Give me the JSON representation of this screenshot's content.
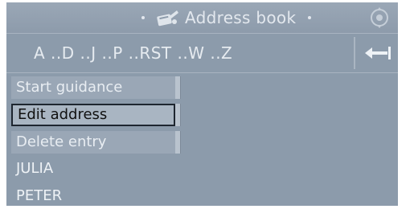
{
  "title_bar": {
    "title": "Address book",
    "book_icon": "address-book-icon",
    "controller_icon": "controller-icon"
  },
  "alpha_bar": {
    "text": "A ..D ..J ..P ..RST ..W ..Z",
    "back_icon": "back-arrow-icon"
  },
  "context_menu": {
    "items": [
      {
        "label": "Start guidance",
        "selected": false
      },
      {
        "label": "Edit address",
        "selected": true
      },
      {
        "label": "Delete entry",
        "selected": false
      }
    ]
  },
  "entries": [
    {
      "label": "JULIA"
    },
    {
      "label": "PETER"
    }
  ],
  "colors": {
    "screen_bg": "#8c9bab",
    "text": "#e8edf2",
    "selected_bg": "#a9b5c2",
    "selected_text": "#111111"
  }
}
